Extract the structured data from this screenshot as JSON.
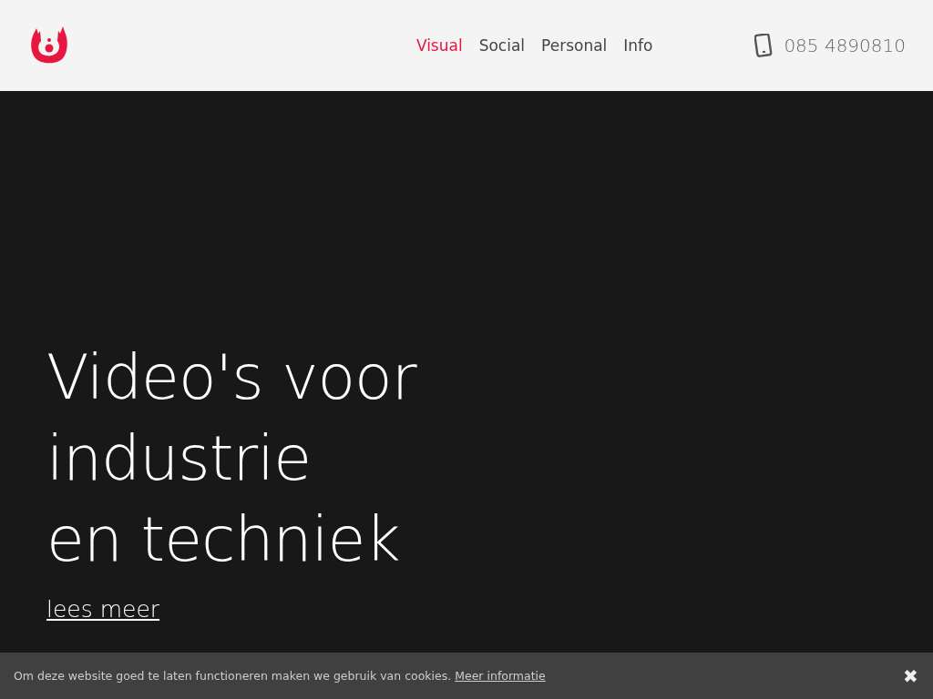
{
  "header": {
    "nav": [
      {
        "label": "Visual",
        "selected": true
      },
      {
        "label": "Social",
        "selected": false
      },
      {
        "label": "Personal",
        "selected": false
      },
      {
        "label": "Info",
        "selected": false
      }
    ],
    "phone": "085 4890810"
  },
  "hero": {
    "title_lines": [
      "Video's voor",
      "industrie",
      "en techniek"
    ],
    "link": "lees meer"
  },
  "cookie_bar": {
    "text": "Om deze website goed te laten functioneren maken we gebruik van cookies.",
    "link": "Meer informatie",
    "close": "✖"
  }
}
